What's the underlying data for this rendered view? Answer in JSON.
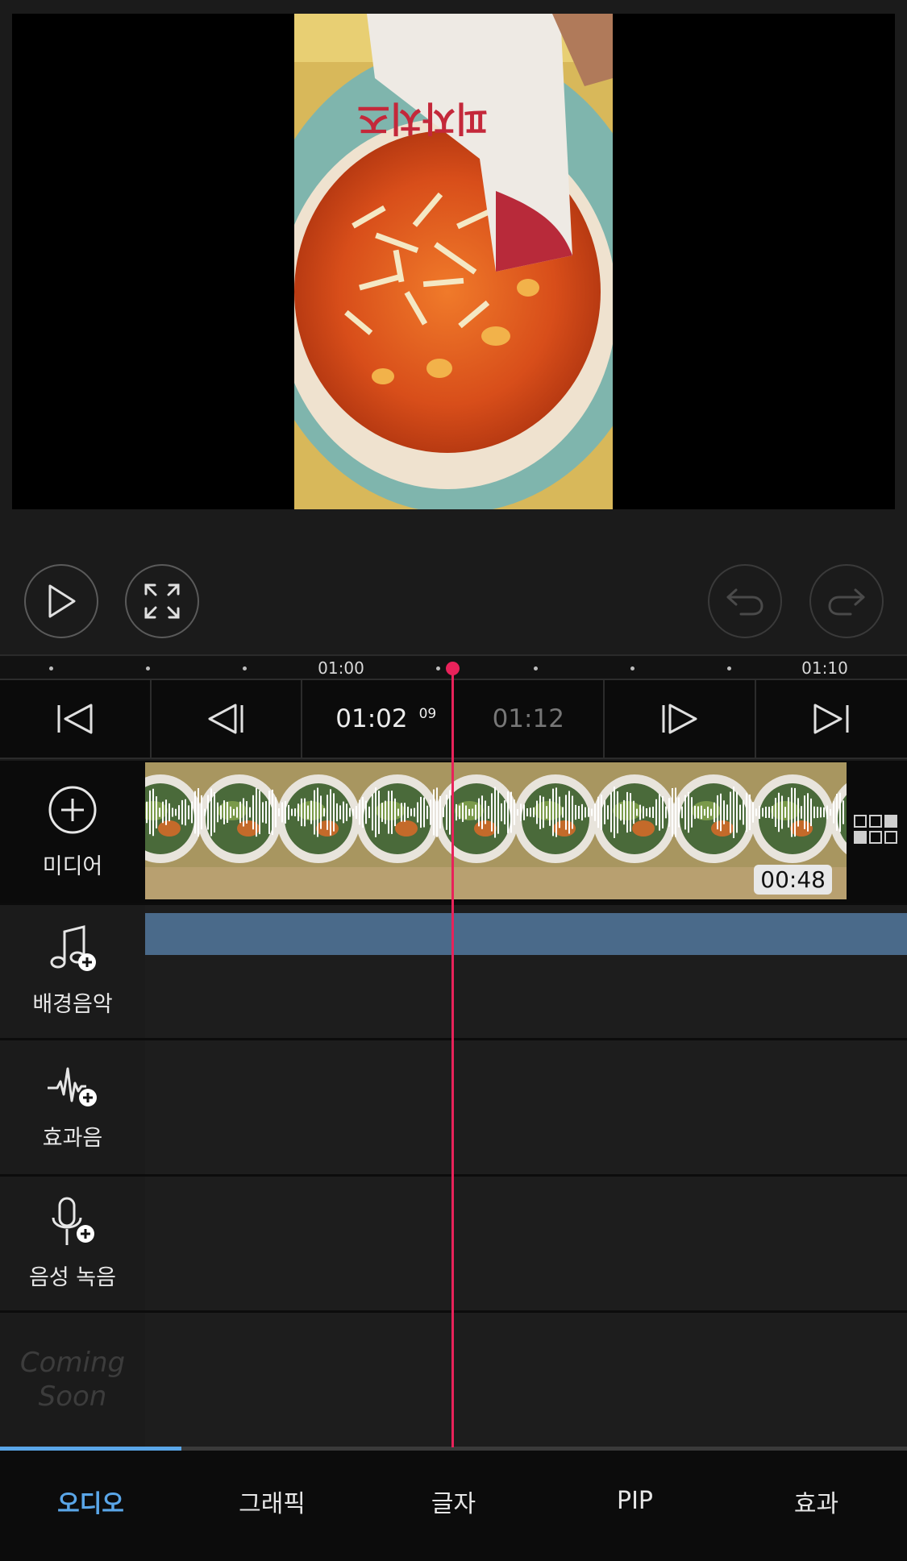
{
  "controls": {
    "play_icon": "play-icon",
    "fullscreen_icon": "fullscreen-icon",
    "undo_icon": "undo-icon",
    "redo_icon": "redo-icon"
  },
  "ruler": {
    "labels": [
      "01:00",
      "01:10"
    ]
  },
  "navigation": {
    "current_time": "01:02",
    "current_frame": "09",
    "end_time": "01:12"
  },
  "tracks": {
    "media": {
      "label": "미디어",
      "duration": "00:48"
    },
    "bgm": {
      "label": "배경음악"
    },
    "sfx": {
      "label": "효과음"
    },
    "voice": {
      "label": "음성 녹음"
    },
    "coming_soon": {
      "label": "Coming Soon"
    }
  },
  "tabs": [
    "오디오",
    "그래픽",
    "글자",
    "PIP",
    "효과"
  ],
  "colors": {
    "accent": "#5aa6e8",
    "playhead": "#e8225a",
    "bgm_clip": "#4a6a8a"
  }
}
